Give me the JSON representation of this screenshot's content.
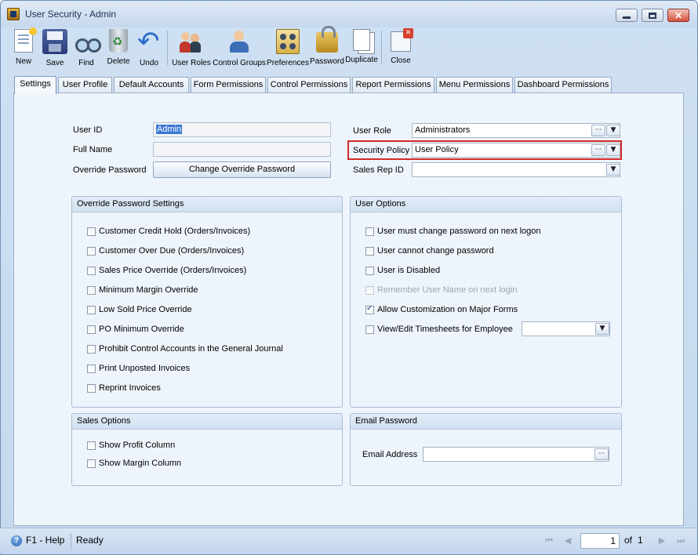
{
  "window": {
    "title": "User Security - Admin"
  },
  "toolbar": [
    {
      "label": "New",
      "icon": "new-icon"
    },
    {
      "label": "Save",
      "icon": "save-icon"
    },
    {
      "label": "Find",
      "icon": "find-icon"
    },
    {
      "label": "Delete",
      "icon": "delete-icon"
    },
    {
      "label": "Undo",
      "icon": "undo-icon"
    },
    {
      "label": "User Roles",
      "icon": "user-roles-icon"
    },
    {
      "label": "Control Groups",
      "icon": "control-groups-icon"
    },
    {
      "label": "Preferences",
      "icon": "preferences-icon"
    },
    {
      "label": "Password",
      "icon": "password-icon"
    },
    {
      "label": "Duplicate",
      "icon": "duplicate-icon"
    },
    {
      "label": "Close",
      "icon": "close-icon"
    }
  ],
  "tabs": [
    "Settings",
    "User Profile",
    "Default Accounts",
    "Form Permissions",
    "Control Permissions",
    "Report Permissions",
    "Menu Permissions",
    "Dashboard Permissions"
  ],
  "active_tab": "Settings",
  "form": {
    "user_id_label": "User ID",
    "user_id_value": "Admin",
    "full_name_label": "Full Name",
    "full_name_value": "",
    "override_password_label": "Override Password",
    "change_override_button": "Change Override Password",
    "user_role_label": "User Role",
    "user_role_value": "Administrators",
    "security_policy_label": "Security Policy",
    "security_policy_value": "User Policy",
    "sales_rep_label": "Sales Rep ID",
    "sales_rep_value": ""
  },
  "override_group": {
    "title": "Override Password Settings",
    "items": [
      {
        "label": "Customer Credit Hold (Orders/Invoices)",
        "checked": false
      },
      {
        "label": "Customer Over Due (Orders/Invoices)",
        "checked": false
      },
      {
        "label": "Sales Price Override (Orders/Invoices)",
        "checked": false
      },
      {
        "label": "Minimum Margin Override",
        "checked": false
      },
      {
        "label": "Low Sold Price Override",
        "checked": false
      },
      {
        "label": "PO Minimum Override",
        "checked": false
      },
      {
        "label": "Prohibit Control Accounts in the General Journal",
        "checked": false
      },
      {
        "label": "Print Unposted Invoices",
        "checked": false
      },
      {
        "label": "Reprint Invoices",
        "checked": false
      }
    ]
  },
  "user_options": {
    "title": "User Options",
    "items": [
      {
        "label": "User must change password on next logon",
        "checked": false,
        "disabled": false
      },
      {
        "label": "User cannot change password",
        "checked": false,
        "disabled": false
      },
      {
        "label": "User is Disabled",
        "checked": false,
        "disabled": false
      },
      {
        "label": "Remember User Name on next login",
        "checked": false,
        "disabled": true
      },
      {
        "label": "Allow Customization on Major Forms",
        "checked": true,
        "disabled": false
      },
      {
        "label": "View/Edit Timesheets for Employee",
        "checked": false,
        "disabled": false
      }
    ],
    "employee_value": ""
  },
  "sales_options": {
    "title": "Sales Options",
    "items": [
      {
        "label": "Show Profit Column",
        "checked": false
      },
      {
        "label": "Show Margin Column",
        "checked": false
      }
    ]
  },
  "email_password": {
    "title": "Email Password",
    "email_label": "Email Address",
    "email_value": ""
  },
  "status": {
    "help": "F1 - Help",
    "state": "Ready",
    "page": "1",
    "of_label": "of",
    "total_pages": "1"
  },
  "colors": {
    "highlight": "#d42a2a",
    "selection": "#3a78d4"
  }
}
